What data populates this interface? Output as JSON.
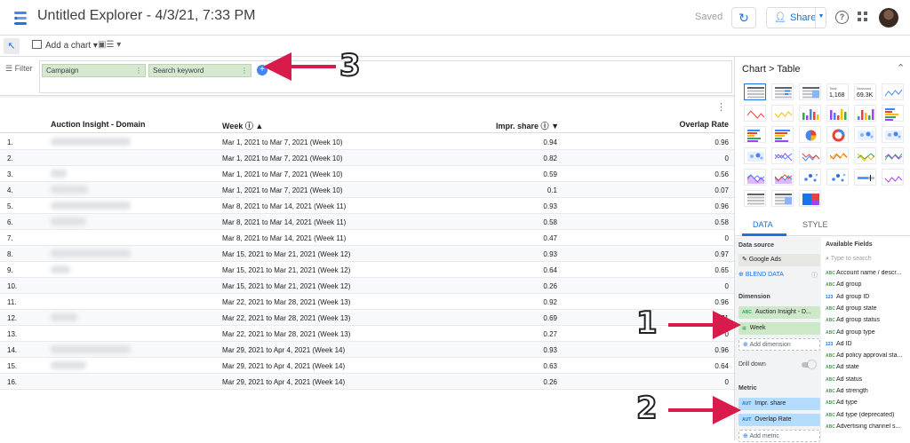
{
  "app": {
    "title": "Untitled Explorer - 4/3/21, 7:33 PM",
    "saved_label": "Saved",
    "share_label": "Share"
  },
  "toolbar": {
    "add_chart": "Add a chart"
  },
  "filter": {
    "label": "Filter",
    "chips": [
      "Campaign",
      "Search keyword"
    ]
  },
  "table": {
    "headers": [
      "Auction Insight - Domain",
      "Week",
      "Impr. share",
      "Overlap Rate"
    ],
    "rows": [
      {
        "n": "1.",
        "week": "Mar 1, 2021 to Mar 7, 2021 (Week 10)",
        "impr": "0.94",
        "overlap": "0.96"
      },
      {
        "n": "2.",
        "week": "Mar 1, 2021 to Mar 7, 2021 (Week 10)",
        "impr": "0.82",
        "overlap": "0"
      },
      {
        "n": "3.",
        "week": "Mar 1, 2021 to Mar 7, 2021 (Week 10)",
        "impr": "0.59",
        "overlap": "0.56"
      },
      {
        "n": "4.",
        "week": "Mar 1, 2021 to Mar 7, 2021 (Week 10)",
        "impr": "0.1",
        "overlap": "0.07"
      },
      {
        "n": "5.",
        "week": "Mar 8, 2021 to Mar 14, 2021 (Week 11)",
        "impr": "0.93",
        "overlap": "0.96"
      },
      {
        "n": "6.",
        "week": "Mar 8, 2021 to Mar 14, 2021 (Week 11)",
        "impr": "0.58",
        "overlap": "0.58"
      },
      {
        "n": "7.",
        "week": "Mar 8, 2021 to Mar 14, 2021 (Week 11)",
        "impr": "0.47",
        "overlap": "0"
      },
      {
        "n": "8.",
        "week": "Mar 15, 2021 to Mar 21, 2021 (Week 12)",
        "impr": "0.93",
        "overlap": "0.97"
      },
      {
        "n": "9.",
        "week": "Mar 15, 2021 to Mar 21, 2021 (Week 12)",
        "impr": "0.64",
        "overlap": "0.65"
      },
      {
        "n": "10.",
        "week": "Mar 15, 2021 to Mar 21, 2021 (Week 12)",
        "impr": "0.26",
        "overlap": "0"
      },
      {
        "n": "11.",
        "week": "Mar 22, 2021 to Mar 28, 2021 (Week 13)",
        "impr": "0.92",
        "overlap": "0.96"
      },
      {
        "n": "12.",
        "week": "Mar 22, 2021 to Mar 28, 2021 (Week 13)",
        "impr": "0.69",
        "overlap": "0.71"
      },
      {
        "n": "13.",
        "week": "Mar 22, 2021 to Mar 28, 2021 (Week 13)",
        "impr": "0.27",
        "overlap": "0"
      },
      {
        "n": "14.",
        "week": "Mar 29, 2021 to Apr 4, 2021 (Week 14)",
        "impr": "0.93",
        "overlap": "0.96"
      },
      {
        "n": "15.",
        "week": "Mar 29, 2021 to Apr 4, 2021 (Week 14)",
        "impr": "0.63",
        "overlap": "0.64"
      },
      {
        "n": "16.",
        "week": "Mar 29, 2021 to Apr 4, 2021 (Week 14)",
        "impr": "0.26",
        "overlap": "0"
      }
    ]
  },
  "panel": {
    "breadcrumb": "Chart > Table",
    "mini_total_label": "Total",
    "mini_total_value": "1,168",
    "mini_sessions_label": "Sessions",
    "mini_sessions_value": "69.3K",
    "tabs": [
      "DATA",
      "STYLE"
    ],
    "data_source_title": "Data source",
    "data_source": "Google Ads",
    "blend": "BLEND DATA",
    "dimension_title": "Dimension",
    "dimensions": [
      "Auction Insight - D...",
      "Week"
    ],
    "add_dimension": "Add dimension",
    "drill_down": "Drill down",
    "metric_title": "Metric",
    "metrics": [
      "Impr. share",
      "Overlap Rate"
    ],
    "add_metric": "Add metric",
    "available_title": "Available Fields",
    "search_placeholder": "Type to search",
    "fields": [
      "Account name / descr...",
      "Ad group",
      "Ad group ID",
      "Ad group state",
      "Ad group status",
      "Ad group type",
      "Ad ID",
      "Ad policy approval sta...",
      "Ad state",
      "Ad status",
      "Ad strength",
      "Ad type",
      "Ad type (deprecated)",
      "Advertising channel s..."
    ],
    "field_types": [
      "ABC",
      "ABC",
      "123",
      "ABC",
      "ABC",
      "ABC",
      "123",
      "ABC",
      "ABC",
      "ABC",
      "ABC",
      "ABC",
      "ABC",
      "ABC"
    ]
  },
  "annotations": [
    "1",
    "2",
    "3"
  ],
  "colors": {
    "accent": "#1a73e8",
    "arrow": "#d81b4a",
    "dimension_chip": "#cde8c8",
    "metric_chip": "#b3dcff"
  }
}
